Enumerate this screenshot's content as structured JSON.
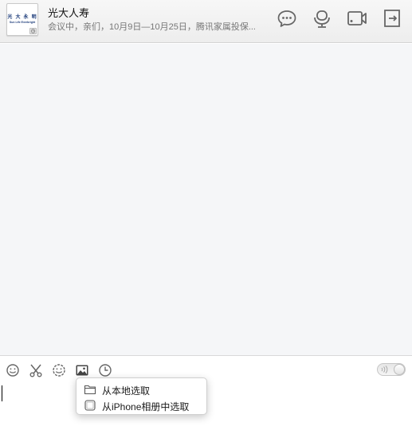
{
  "header": {
    "title": "光大人寿",
    "subtitle": "会议中，亲们，10月9日—10月25日，腾讯家属投保...",
    "avatar_logo_cn": "光 大 永 明",
    "avatar_logo_en": "Sun Life Everbright",
    "buttons": [
      {
        "name": "chat-bubble-icon"
      },
      {
        "name": "voice-call-icon"
      },
      {
        "name": "video-call-icon"
      },
      {
        "name": "exit-icon"
      }
    ]
  },
  "toolbar": {
    "icons": [
      "emoji-icon",
      "screenshot-scissors-icon",
      "magic-emoji-icon",
      "image-icon",
      "history-clock-icon"
    ]
  },
  "image_menu": {
    "items": [
      {
        "label": "从本地选取",
        "icon": "folder-icon"
      },
      {
        "label": "从iPhone相册中选取",
        "icon": "iphone-icon"
      }
    ]
  },
  "colors": {
    "chat_background": "#f5f6f8",
    "header_background": "#eeeeee",
    "icon_gray": "#666666"
  }
}
